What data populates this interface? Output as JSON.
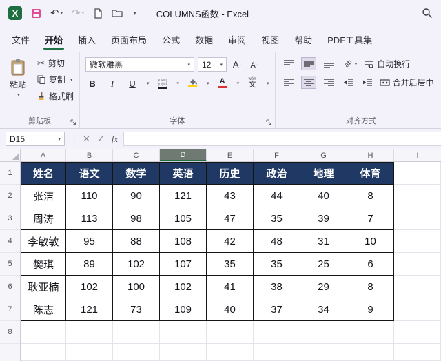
{
  "window": {
    "title": "COLUMNS函数  -  Excel"
  },
  "tabs": {
    "items": [
      "文件",
      "开始",
      "插入",
      "页面布局",
      "公式",
      "数据",
      "审阅",
      "视图",
      "帮助",
      "PDF工具集"
    ],
    "active": "开始"
  },
  "ribbon": {
    "clipboard": {
      "paste": "粘贴",
      "cut": "剪切",
      "copy": "复制",
      "format_painter": "格式刷",
      "group": "剪贴板"
    },
    "font": {
      "family": "微软雅黑",
      "size": "12",
      "bold": "B",
      "italic": "I",
      "underline": "U",
      "phonetic": "文",
      "phonetic_guide": "wén",
      "group": "字体"
    },
    "alignment": {
      "orientation": "ab",
      "wrap_text": "自动换行",
      "merge_center": "合并后居中",
      "group": "对齐方式"
    }
  },
  "formula_bar": {
    "name_box": "D15",
    "cancel": "✕",
    "enter": "✓",
    "fx": "fx",
    "value": ""
  },
  "sheet": {
    "column_headers": [
      "A",
      "B",
      "C",
      "D",
      "E",
      "F",
      "G",
      "H",
      "I"
    ],
    "active_column": "D",
    "row_numbers": [
      "1",
      "2",
      "3",
      "4",
      "5",
      "6",
      "7",
      "8"
    ],
    "table_header": [
      "姓名",
      "语文",
      "数学",
      "英语",
      "历史",
      "政治",
      "地理",
      "体育"
    ],
    "rows": [
      [
        "张洁",
        "110",
        "90",
        "121",
        "43",
        "44",
        "40",
        "8"
      ],
      [
        "周涛",
        "113",
        "98",
        "105",
        "47",
        "35",
        "39",
        "7"
      ],
      [
        "李敏敏",
        "95",
        "88",
        "108",
        "42",
        "48",
        "31",
        "10"
      ],
      [
        "樊琪",
        "89",
        "102",
        "107",
        "35",
        "35",
        "25",
        "6"
      ],
      [
        "耿亚楠",
        "102",
        "100",
        "102",
        "41",
        "38",
        "29",
        "8"
      ],
      [
        "陈志",
        "121",
        "73",
        "109",
        "40",
        "37",
        "34",
        "9"
      ]
    ]
  },
  "colors": {
    "accent_green": "#1e7145",
    "table_header_bg": "#1f3864",
    "save_icon_pink": "#df4b97",
    "selected_column_bg": "#6e7a72",
    "chrome_bg": "#f3f1f9"
  }
}
